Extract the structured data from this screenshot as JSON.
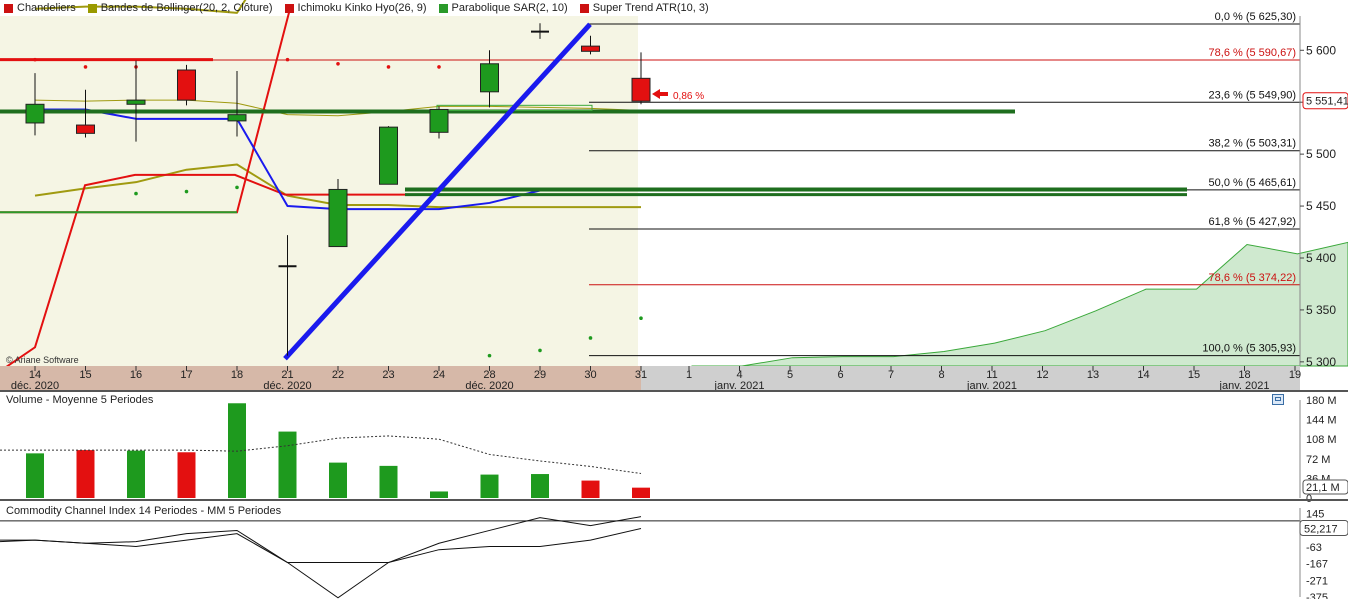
{
  "legend": [
    {
      "label": "Chandeliers",
      "color": "#cc1111"
    },
    {
      "label": "Bandes de Bollinger(20, 2, Clôture)",
      "color": "#9a9a00"
    },
    {
      "label": "Ichimoku Kinko Hyo(26, 9)",
      "color": "#cc1111"
    },
    {
      "label": "Parabolique SAR(2, 10)",
      "color": "#2a9a2a"
    },
    {
      "label": "Super Trend ATR(10, 3)",
      "color": "#cc1111"
    }
  ],
  "credit": "© Ariane Software",
  "colors": {
    "up": "#1e9a1e",
    "down": "#e31010",
    "trend": "#1a1aee",
    "bollinger": "#a09a10",
    "green_line": "#1e6e1e",
    "cloud": "#cfe9cf"
  },
  "chart_data": {
    "type": "candlestick",
    "x_labels": [
      "14",
      "15",
      "16",
      "17",
      "18",
      "21",
      "22",
      "23",
      "24",
      "28",
      "29",
      "30",
      "31",
      "1",
      "4",
      "5",
      "6",
      "7",
      "8",
      "11",
      "12",
      "13",
      "14",
      "15",
      "18",
      "19"
    ],
    "month_labels": [
      {
        "text": "déc. 2020",
        "at": 0
      },
      {
        "text": "déc. 2020",
        "at": 5
      },
      {
        "text": "déc. 2020",
        "at": 9
      },
      {
        "text": "janv. 2021",
        "at": 14
      },
      {
        "text": "janv. 2021",
        "at": 19
      },
      {
        "text": "janv. 2021",
        "at": 24
      }
    ],
    "candles": [
      {
        "o": 5530,
        "h": 5578,
        "l": 5518,
        "c": 5548
      },
      {
        "o": 5528,
        "h": 5562,
        "l": 5516,
        "c": 5520
      },
      {
        "o": 5548,
        "h": 5590,
        "l": 5512,
        "c": 5552
      },
      {
        "o": 5581,
        "h": 5586,
        "l": 5547,
        "c": 5552
      },
      {
        "o": 5532,
        "h": 5580,
        "l": 5517,
        "c": 5538
      },
      {
        "o": 5392,
        "h": 5422,
        "l": 5306,
        "c": 5392
      },
      {
        "o": 5411,
        "h": 5476,
        "l": 5411,
        "c": 5466
      },
      {
        "o": 5471,
        "h": 5527,
        "l": 5471,
        "c": 5526
      },
      {
        "o": 5521,
        "h": 5546,
        "l": 5515,
        "c": 5543
      },
      {
        "o": 5560,
        "h": 5600,
        "l": 5545,
        "c": 5587
      },
      {
        "o": 5618,
        "h": 5626,
        "l": 5611,
        "c": 5618
      },
      {
        "o": 5604,
        "h": 5614,
        "l": 5596,
        "c": 5599
      },
      {
        "o": 5573,
        "h": 5598,
        "l": 5548,
        "c": 5551
      }
    ],
    "ylim": [
      5296,
      5633
    ],
    "y_ticks": [
      {
        "v": 5600,
        "label": "5 600"
      },
      {
        "v": 5550,
        "label": "5 550"
      },
      {
        "v": 5500,
        "label": "5 500"
      },
      {
        "v": 5450,
        "label": "5 450"
      },
      {
        "v": 5400,
        "label": "5 400"
      },
      {
        "v": 5350,
        "label": "5 350"
      },
      {
        "v": 5300,
        "label": "5 300"
      }
    ],
    "last_price": "5 551,41",
    "change_label": "0,86 %",
    "fibonacci": [
      {
        "v": 5625.3,
        "label": "0,0 % (5 625,30)",
        "color": "#111111"
      },
      {
        "v": 5590.67,
        "label": "78,6 % (5 590,67)",
        "color": "#cc1111"
      },
      {
        "v": 5549.9,
        "label": "23,6 % (5 549,90)",
        "color": "#111111"
      },
      {
        "v": 5503.31,
        "label": "38,2 % (5 503,31)",
        "color": "#111111"
      },
      {
        "v": 5465.61,
        "label": "50,0 % (5 465,61)",
        "color": "#111111"
      },
      {
        "v": 5427.92,
        "label": "61,8 % (5 427,92)",
        "color": "#111111"
      },
      {
        "v": 5374.22,
        "label": "78,6 % (5 374,22)",
        "color": "#cc1111"
      },
      {
        "v": 5305.93,
        "label": "100,0 % (5 305,93)",
        "color": "#111111"
      }
    ],
    "bollinger_upper": [
      5640,
      5642,
      5642,
      5640,
      5636,
      5712,
      5730,
      5740,
      5740,
      5740,
      5740,
      5740,
      5740
    ],
    "bollinger_middle": [
      5552,
      5551,
      5552,
      5552,
      5549,
      5538,
      5537,
      5541,
      5546,
      5546,
      5545,
      5544,
      5542
    ],
    "bollinger_lower": [
      5460,
      5467,
      5473,
      5485,
      5490,
      5460,
      5451,
      5451,
      5449,
      5449,
      5449,
      5449,
      5449
    ],
    "sar_points": [
      5591,
      5584,
      5584,
      5584,
      5589,
      5591,
      5587,
      5584,
      5584,
      5584,
      5584,
      5584,
      5584
    ],
    "sar_points_low": [
      5441,
      5441,
      5462,
      5464,
      5468,
      5441,
      5441,
      5441,
      5441,
      5306,
      5311,
      5323,
      5342
    ],
    "supertrend_red": [
      5300,
      5470,
      5480,
      5480,
      5480,
      5461,
      5461,
      5461,
      5461,
      5465,
      5465,
      5465,
      5465
    ],
    "kijun": [
      5543,
      5543,
      5534,
      5534,
      5534,
      5450,
      5447,
      5447,
      5447,
      5453,
      5465,
      5465,
      5465
    ],
    "tenkan_green": [
      5444,
      5444,
      5444,
      5444,
      5444
    ],
    "cloud": [
      [
        13,
        5296
      ],
      [
        14,
        5296
      ],
      [
        15,
        5304
      ],
      [
        16,
        5305
      ],
      [
        17,
        5305
      ],
      [
        18,
        5310
      ],
      [
        19,
        5318
      ],
      [
        20,
        5330
      ],
      [
        21,
        5349
      ],
      [
        22,
        5370
      ],
      [
        23,
        5370
      ],
      [
        24,
        5413
      ],
      [
        25,
        5404
      ],
      [
        26,
        5415
      ],
      [
        26,
        5296
      ]
    ],
    "volume": {
      "title": "Volume  -  Moyenne 5 Periodes",
      "values": [
        82,
        88,
        87,
        84,
        174,
        122,
        65,
        59,
        12,
        43,
        44,
        32,
        19
      ],
      "ma": [
        88,
        88,
        88,
        88,
        86,
        96,
        110,
        114,
        108,
        80,
        68,
        58,
        45
      ],
      "ylim": [
        0,
        180
      ],
      "ticks": [
        {
          "v": 180,
          "label": "180 M"
        },
        {
          "v": 144,
          "label": "144 M"
        },
        {
          "v": 108,
          "label": "108 M"
        },
        {
          "v": 72,
          "label": "72 M"
        },
        {
          "v": 36,
          "label": "36 M"
        },
        {
          "v": 0,
          "label": "0"
        }
      ],
      "last": "21,1 M"
    },
    "cci": {
      "title": "Commodity Channel Index 14 Periodes - MM  5 Periodes",
      "cci": [
        -20,
        -40,
        -60,
        -20,
        20,
        -160,
        -380,
        -160,
        -40,
        40,
        120,
        70,
        126
      ],
      "ma": [
        -20,
        -40,
        -30,
        20,
        40,
        -160,
        -160,
        -160,
        -80,
        -60,
        -60,
        -20,
        52
      ],
      "ylim": [
        -375,
        180
      ],
      "ticks": [
        {
          "v": 145,
          "label": "145"
        },
        {
          "v": -63,
          "label": "-63"
        },
        {
          "v": -167,
          "label": "-167"
        },
        {
          "v": -271,
          "label": "-271"
        },
        {
          "v": -375,
          "label": "-375"
        }
      ],
      "last": "52,217"
    }
  }
}
